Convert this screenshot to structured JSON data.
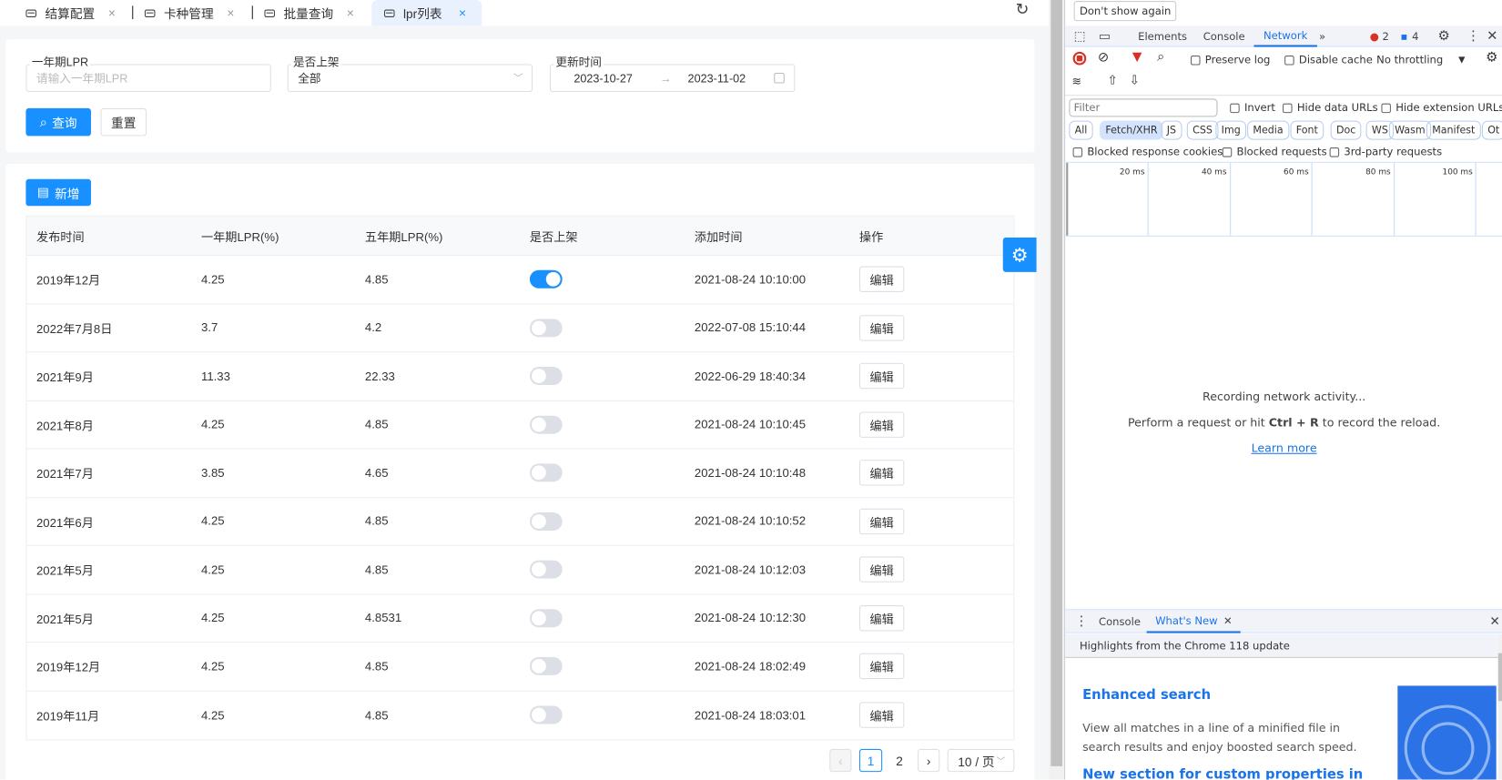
{
  "tabs": [
    {
      "label": "结算配置",
      "active": false
    },
    {
      "label": "卡种管理",
      "active": false
    },
    {
      "label": "批量查询",
      "active": false
    },
    {
      "label": "lpr列表",
      "active": true
    }
  ],
  "search": {
    "lpr1_label": "一年期LPR",
    "lpr1_placeholder": "请输入一年期LPR",
    "status_label": "是否上架",
    "status_value": "全部",
    "date_label": "更新时间",
    "date_start": "2023-10-27",
    "date_end": "2023-11-02",
    "query_btn": "查询",
    "reset_btn": "重置"
  },
  "add_btn": "新增",
  "table": {
    "headers": [
      "发布时间",
      "一年期LPR(%)",
      "五年期LPR(%)",
      "是否上架",
      "添加时间",
      "操作"
    ],
    "edit_label": "编辑",
    "rows": [
      {
        "date": "2019年12月",
        "lpr1": "4.25",
        "lpr5": "4.85",
        "on": true,
        "added": "2021-08-24 10:10:00"
      },
      {
        "date": "2022年7月8日",
        "lpr1": "3.7",
        "lpr5": "4.2",
        "on": false,
        "added": "2022-07-08 15:10:44"
      },
      {
        "date": "2021年9月",
        "lpr1": "11.33",
        "lpr5": "22.33",
        "on": false,
        "added": "2022-06-29 18:40:34"
      },
      {
        "date": "2021年8月",
        "lpr1": "4.25",
        "lpr5": "4.85",
        "on": false,
        "added": "2021-08-24 10:10:45"
      },
      {
        "date": "2021年7月",
        "lpr1": "3.85",
        "lpr5": "4.65",
        "on": false,
        "added": "2021-08-24 10:10:48"
      },
      {
        "date": "2021年6月",
        "lpr1": "4.25",
        "lpr5": "4.85",
        "on": false,
        "added": "2021-08-24 10:10:52"
      },
      {
        "date": "2021年5月",
        "lpr1": "4.25",
        "lpr5": "4.85",
        "on": false,
        "added": "2021-08-24 10:12:03"
      },
      {
        "date": "2021年5月",
        "lpr1": "4.25",
        "lpr5": "4.8531",
        "on": false,
        "added": "2021-08-24 10:12:30"
      },
      {
        "date": "2019年12月",
        "lpr1": "4.25",
        "lpr5": "4.85",
        "on": false,
        "added": "2021-08-24 18:02:49"
      },
      {
        "date": "2019年11月",
        "lpr1": "4.25",
        "lpr5": "4.85",
        "on": false,
        "added": "2021-08-24 18:03:01"
      }
    ]
  },
  "pagination": {
    "pages": [
      "1",
      "2"
    ],
    "current": "1",
    "page_size": "10 / 页"
  },
  "devtools": {
    "dont_show": "Don't show again",
    "tabs": [
      "Elements",
      "Console",
      "Network"
    ],
    "active_tab": "Network",
    "errors": "2",
    "messages": "4",
    "preserve_log": "Preserve log",
    "disable_cache": "Disable cache",
    "throttling": "No throttling",
    "filter_placeholder": "Filter",
    "invert": "Invert",
    "hide_data": "Hide data URLs",
    "hide_ext": "Hide extension URLs",
    "types": [
      "All",
      "Fetch/XHR",
      "JS",
      "CSS",
      "Img",
      "Media",
      "Font",
      "Doc",
      "WS",
      "Wasm",
      "Manifest",
      "Ot"
    ],
    "selected_type": "Fetch/XHR",
    "blocked_cookies": "Blocked response cookies",
    "blocked_requests": "Blocked requests",
    "third_party": "3rd-party requests",
    "timeline": [
      "20 ms",
      "40 ms",
      "60 ms",
      "80 ms",
      "100 ms"
    ],
    "recording": "Recording network activity...",
    "perform_pre": "Perform a request or hit ",
    "perform_keys": "Ctrl + R",
    "perform_post": " to record the reload.",
    "learn_more": "Learn more",
    "drawer_tabs": [
      "Console",
      "What's New"
    ],
    "highlights": "Highlights from the Chrome 118 update",
    "feature_title": "Enhanced search",
    "feature_desc1": "View all matches in a line of a minified file in",
    "feature_desc2": "search results and enjoy boosted search speed.",
    "next_title": "New section for custom properties in"
  },
  "colors": {
    "primary": "#1890ff",
    "devtools_accent": "#1a73e8"
  }
}
